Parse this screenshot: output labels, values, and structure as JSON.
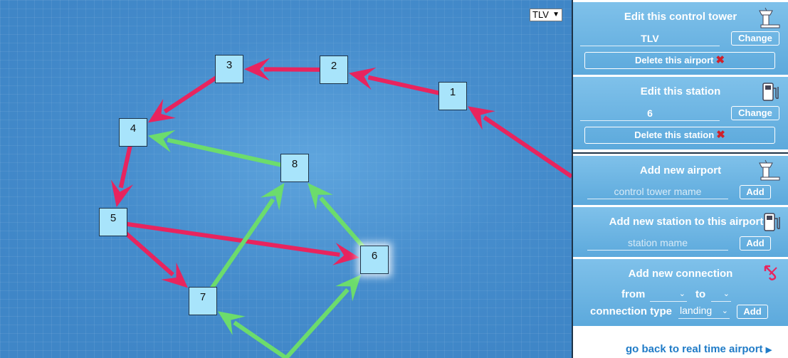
{
  "airport_select": {
    "value": "TLV"
  },
  "graph": {
    "colors": {
      "flow": "#e8245e",
      "connection": "#6cdc6c"
    },
    "nodes": [
      {
        "id": "1",
        "label": "1"
      },
      {
        "id": "2",
        "label": "2"
      },
      {
        "id": "3",
        "label": "3"
      },
      {
        "id": "4",
        "label": "4"
      },
      {
        "id": "5",
        "label": "5"
      },
      {
        "id": "6",
        "label": "6",
        "selected": true
      },
      {
        "id": "7",
        "label": "7"
      },
      {
        "id": "8",
        "label": "8"
      }
    ],
    "edges": [
      {
        "from": "entry-right",
        "to": "1",
        "kind": "flow"
      },
      {
        "from": "1",
        "to": "2",
        "kind": "flow"
      },
      {
        "from": "2",
        "to": "3",
        "kind": "flow"
      },
      {
        "from": "3",
        "to": "4",
        "kind": "flow"
      },
      {
        "from": "4",
        "to": "5",
        "kind": "flow"
      },
      {
        "from": "5",
        "to": "6",
        "kind": "flow"
      },
      {
        "from": "5",
        "to": "7",
        "kind": "flow"
      },
      {
        "from": "8",
        "to": "4",
        "kind": "connection"
      },
      {
        "from": "7",
        "to": "8",
        "kind": "connection"
      },
      {
        "from": "6",
        "to": "8",
        "kind": "connection"
      },
      {
        "from": "entry-bottom",
        "to": "7",
        "kind": "connection"
      },
      {
        "from": "entry-bottom",
        "to": "6",
        "kind": "connection"
      }
    ]
  },
  "panel": {
    "edit_tower": {
      "title": "Edit this control tower",
      "value": "TLV",
      "change_label": "Change",
      "delete_label": "Delete this airport",
      "icon": "control-tower-icon"
    },
    "edit_station": {
      "title": "Edit this station",
      "value": "6",
      "change_label": "Change",
      "delete_label": "Delete this station",
      "icon": "fuel-station-icon"
    },
    "add_airport": {
      "title": "Add new airport",
      "placeholder": "control tower mame",
      "add_label": "Add",
      "icon": "control-tower-icon"
    },
    "add_station": {
      "title": "Add new station to this airport",
      "placeholder": "station mame",
      "add_label": "Add",
      "icon": "fuel-station-icon"
    },
    "add_connection": {
      "title": "Add new connection",
      "from_label": "from",
      "to_label": "to",
      "from_value": "",
      "to_value": "",
      "type_label": "connection type",
      "type_value": "landing",
      "add_label": "Add",
      "icon": "connection-arrow-icon"
    },
    "go_back": "go back to real time airport"
  }
}
